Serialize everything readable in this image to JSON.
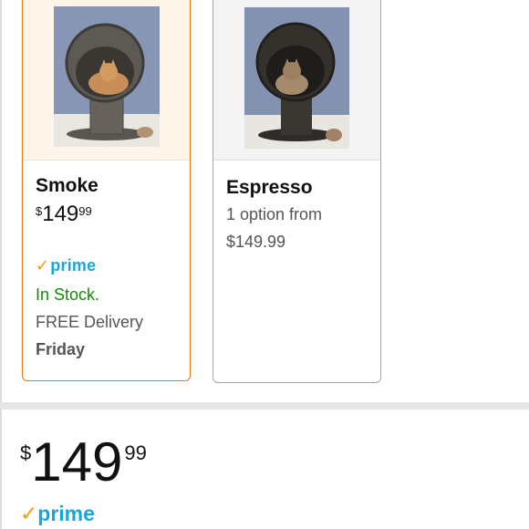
{
  "options": [
    {
      "name": "Smoke",
      "price": {
        "symbol": "$",
        "whole": "149",
        "fraction": "99"
      },
      "prime_label": "prime",
      "prime_check": "✓",
      "stock": "In Stock.",
      "delivery_label": "FREE Delivery",
      "delivery_day": "Friday",
      "selected": true
    },
    {
      "name": "Espresso",
      "options_text": "1 option from",
      "options_price": "$149.99",
      "selected": false
    }
  ],
  "buybox": {
    "price": {
      "symbol": "$",
      "whole": "149",
      "fraction": "99"
    },
    "prime_label": "prime",
    "prime_check": "✓"
  },
  "colors": {
    "selected_border": "#e47911",
    "unselected_border": "#a6a6a6",
    "prime_blue": "#1ba5d8",
    "prime_check": "#f39c12",
    "in_stock_green": "#138a07"
  }
}
